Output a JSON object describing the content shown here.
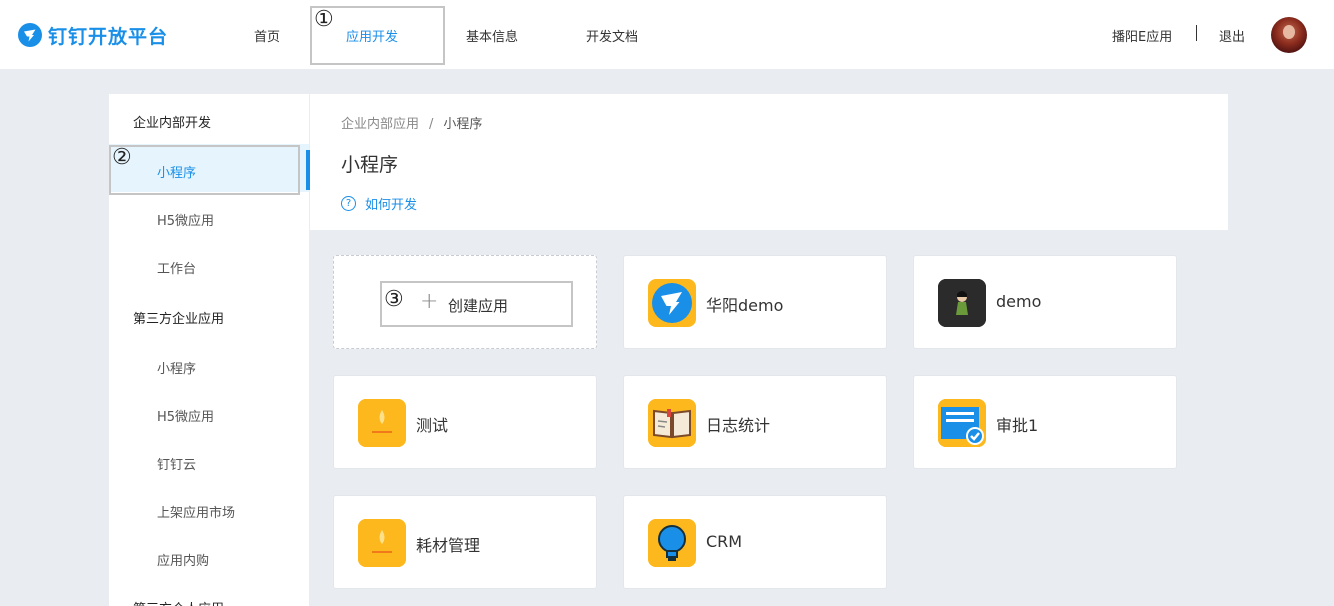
{
  "header": {
    "logo_text": "钉钉开放平台",
    "nav": [
      {
        "label": "首页"
      },
      {
        "label": "应用开发"
      },
      {
        "label": "基本信息"
      },
      {
        "label": "开发文档"
      }
    ],
    "org_name": "播阳E应用",
    "logout_label": "退出"
  },
  "annotations": [
    "①",
    "②",
    "③"
  ],
  "sidebar": {
    "groups": [
      {
        "title": "企业内部开发",
        "items": [
          "小程序",
          "H5微应用",
          "工作台"
        ]
      },
      {
        "title": "第三方企业应用",
        "items": [
          "小程序",
          "H5微应用",
          "钉钉云",
          "上架应用市场",
          "应用内购"
        ]
      },
      {
        "title": "第三方个人应用"
      }
    ]
  },
  "content": {
    "breadcrumb": [
      "企业内部应用",
      "小程序"
    ],
    "breadcrumb_sep": "/",
    "title": "小程序",
    "howto_label": "如何开发",
    "create_label": "创建应用",
    "apps": [
      {
        "name": "华阳demo",
        "icon": "dingtalk-app-icon"
      },
      {
        "name": "demo",
        "icon": "character-app-icon"
      },
      {
        "name": "测试",
        "icon": "yellow-default-app-icon"
      },
      {
        "name": "日志统计",
        "icon": "book-app-icon"
      },
      {
        "name": "审批1",
        "icon": "approval-app-icon"
      },
      {
        "name": "耗材管理",
        "icon": "yellow-default-app-icon"
      },
      {
        "name": "CRM",
        "icon": "lightbulb-app-icon"
      }
    ]
  },
  "colors": {
    "accent": "#1a8fe8",
    "background": "#e9ecf0",
    "app_icon_yellow": "#fdb81e"
  }
}
